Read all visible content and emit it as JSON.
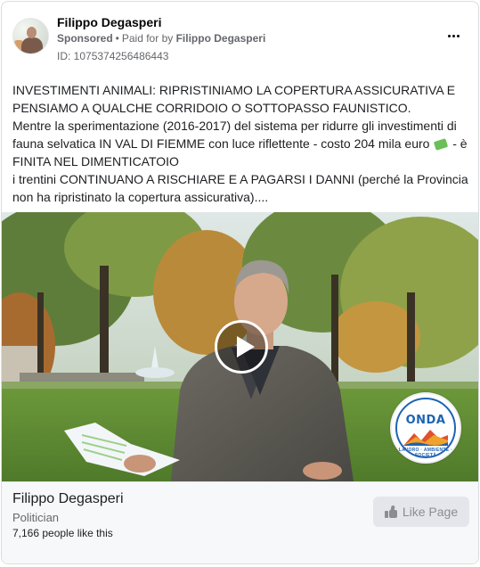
{
  "post": {
    "page_name": "Filippo Degasperi",
    "sponsored_label": "Sponsored",
    "separator": "•",
    "paid_prefix": "Paid for by",
    "paid_by": "Filippo Degasperi",
    "ad_id": "ID: 1075374256486443",
    "more_icon": "more-horizontal-icon",
    "text_lines": [
      "INVESTIMENTI ANIMALI: RIPRISTINIAMO LA COPERTURA ASSICURATIVA E",
      "PENSIAMO A QUALCHE CORRIDOIO O SOTTOPASSO FAUNISTICO.",
      "Mentre la sperimentazione (2016-2017) del sistema per ridurre gli investimenti di",
      "fauna selvatica IN VAL DI FIEMME con luce riflettente - costo 204 mila euro",
      "- è",
      "FINITA NEL DIMENTICATOIO",
      "i trentini CONTINUANO A RISCHIARE E A PAGARSI I DANNI (perché la Provincia",
      "non ha ripristinato la copertura assicurativa)...."
    ],
    "money_icon": "money-with-wings-icon"
  },
  "media": {
    "play_icon": "play-icon",
    "logo": {
      "word": "ONDA",
      "tagline": "LAVORO · AMBIENTE · SOCIETÀ"
    }
  },
  "footer": {
    "page_name": "Filippo Degasperi",
    "category": "Politician",
    "likes": "7,166 people like this",
    "like_button_label": "Like Page",
    "like_icon": "thumbs-up-icon"
  },
  "colors": {
    "text_primary": "#050505",
    "text_secondary": "#65676b",
    "footer_bg": "#f7f8fa",
    "button_bg": "#e4e6eb",
    "logo_blue": "#1f63b3"
  }
}
